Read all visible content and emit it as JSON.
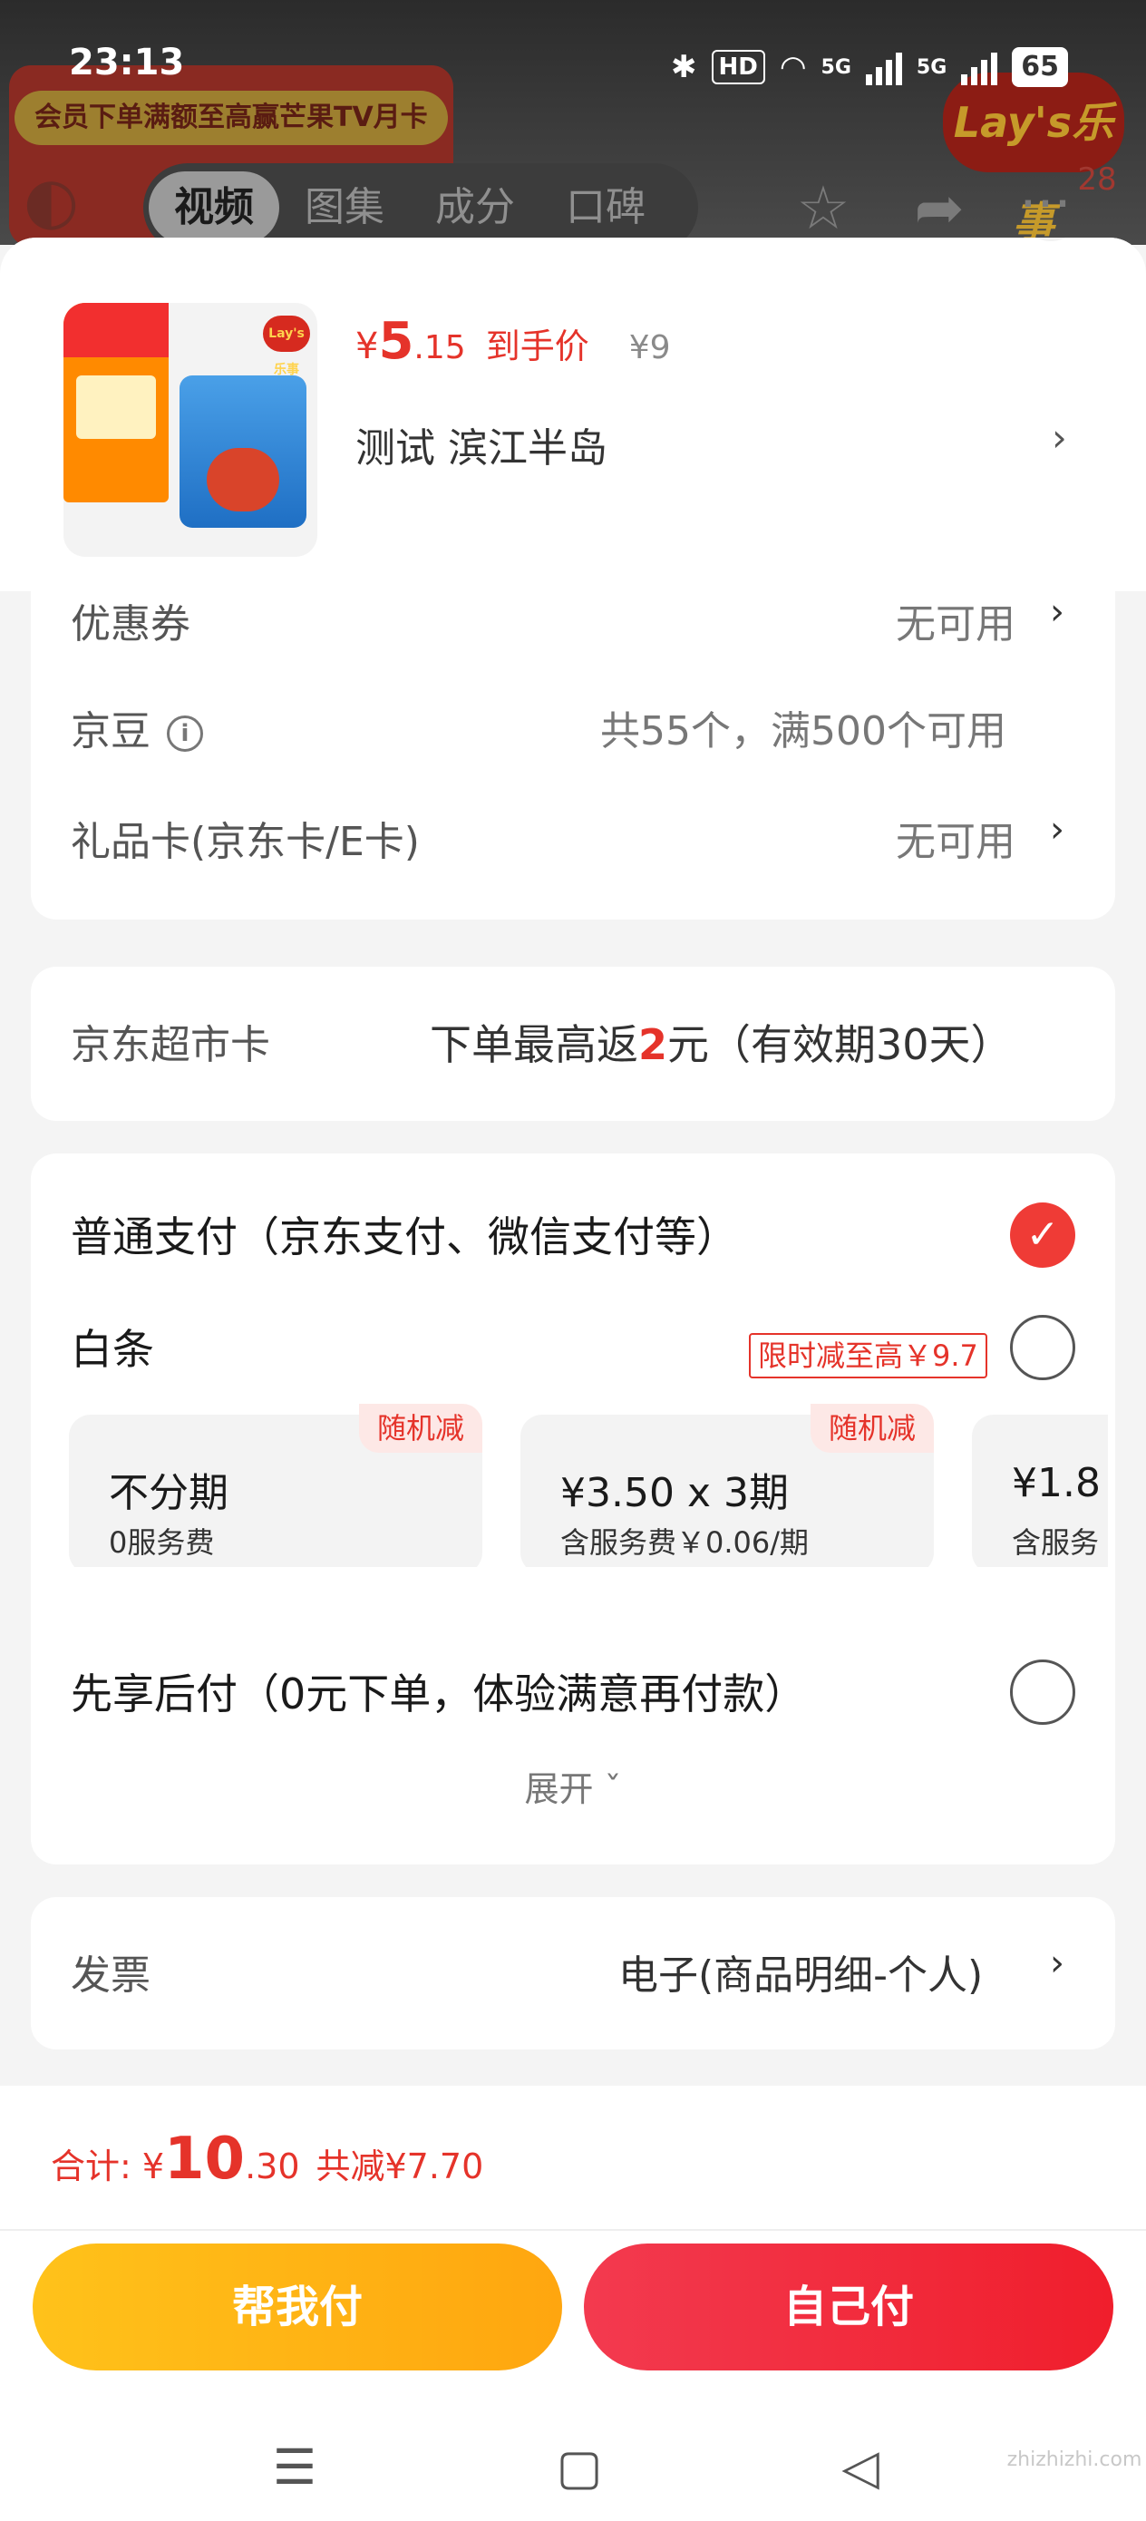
{
  "status_bar": {
    "time": "23:13",
    "bluetooth_icon": "bluetooth-icon",
    "hd": "HD",
    "net_5g_a": "5G",
    "net_5g_b": "5G",
    "battery": "65"
  },
  "background": {
    "promo": "会员下单满额至高赢芒果TV月卡",
    "tabs": [
      "视频",
      "图集",
      "成分",
      "口碑"
    ],
    "brand_logo": "Lay's乐事",
    "badge": "28"
  },
  "product": {
    "price_symbol": "¥",
    "price_int": "5",
    "price_dec": ".15",
    "price_label": "到手价",
    "original_price": "¥9",
    "address": "测试  滨江半岛",
    "chevron": "›",
    "close": "×"
  },
  "discounts": {
    "coupon_label": "优惠券",
    "coupon_value": "无可用",
    "jingdou_label": "京豆",
    "jingdou_info": "i",
    "jingdou_value": "共55个，满500个可用",
    "giftcard_label": "礼品卡(京东卡/E卡)",
    "giftcard_value": "无可用"
  },
  "market_card": {
    "label": "京东超市卡",
    "value_prefix": "下单最高返",
    "value_highlight": "2",
    "value_suffix": "元（有效期30天）"
  },
  "payment": {
    "normal_label": "普通支付（京东支付、微信支付等）",
    "baitiao_label": "白条",
    "baitiao_promo": "限时减至高￥9.7",
    "plans": [
      {
        "title": "不分期",
        "subtitle": "0服务费",
        "tag": "随机减"
      },
      {
        "title": "¥3.50 x 3期",
        "subtitle": "含服务费￥0.06/期",
        "tag": "随机减"
      },
      {
        "title": "¥1.8",
        "subtitle": "含服务",
        "tag": ""
      }
    ],
    "later_label": "先享后付（0元下单，体验满意再付款）",
    "expand_label": "展开 ˇ"
  },
  "invoice": {
    "label": "发票",
    "value": "电子(商品明细-个人)"
  },
  "footer": {
    "total_label": "合计:",
    "total_symbol": "¥",
    "total_int": "10",
    "total_dec": ".30",
    "total_saved": "共减¥7.70",
    "help_pay": "帮我付",
    "self_pay": "自己付"
  },
  "nav": {
    "menu_icon": "☰",
    "home_icon": "▢",
    "back_icon": "◁"
  },
  "watermark": "zhizhizhi.com",
  "colors": {
    "accent_red": "#e5332a",
    "help_pay_yellow": "#ffb114",
    "self_pay_red": "#f22a3a"
  }
}
